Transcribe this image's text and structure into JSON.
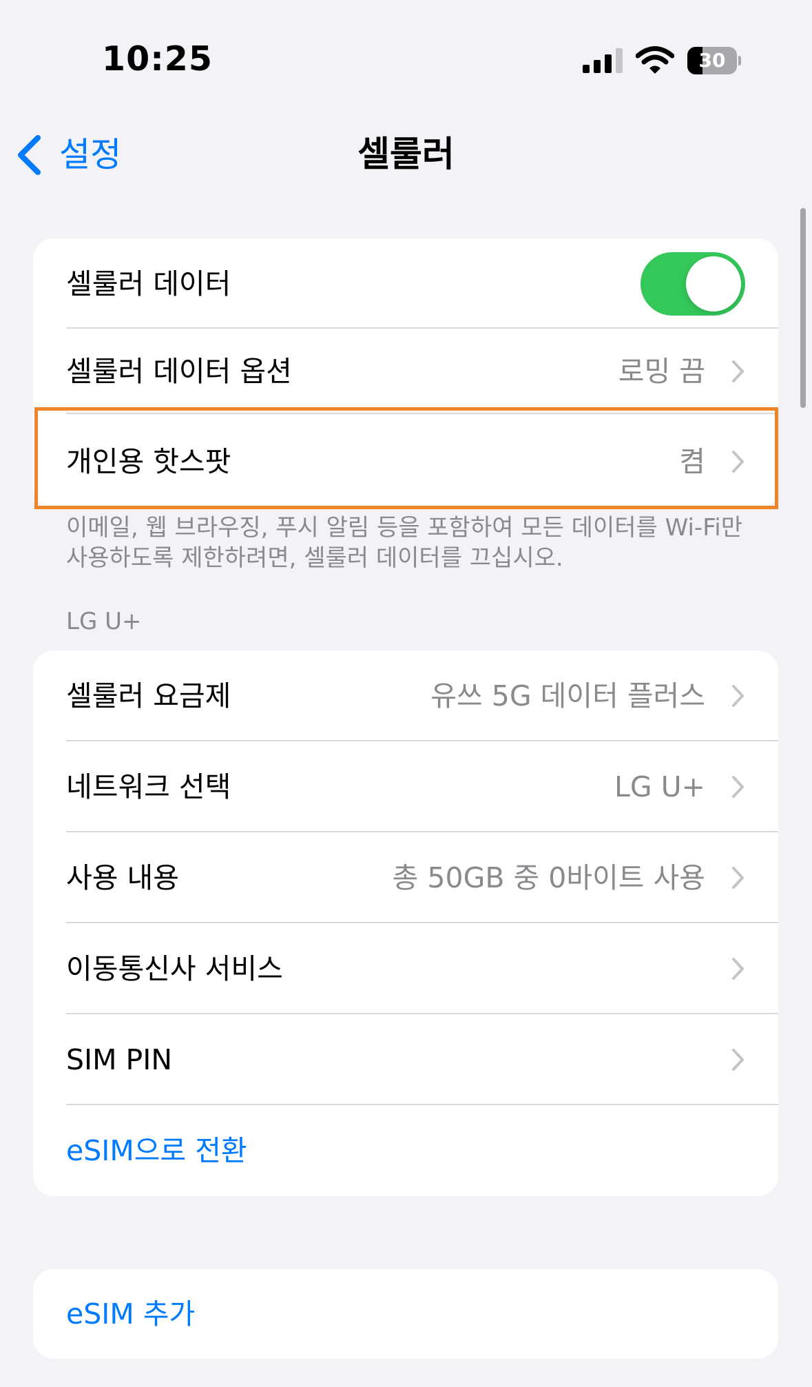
{
  "status_bar": {
    "time": "10:25",
    "battery_level": "30",
    "battery_fraction": 0.3,
    "icons": [
      "cellular-signal-icon",
      "wifi-icon",
      "battery-icon"
    ]
  },
  "nav": {
    "back_label": "설정",
    "title": "셀룰러"
  },
  "colors": {
    "accent": "#007aff",
    "toggle_on": "#34c759",
    "highlight": "#f08428",
    "background": "#f2f2f7"
  },
  "group1": {
    "cellular_data": {
      "label": "셀룰러 데이터",
      "toggle_on": true
    },
    "cellular_data_options": {
      "label": "셀룰러 데이터 옵션",
      "value": "로밍 끔"
    },
    "personal_hotspot": {
      "label": "개인용 핫스팟",
      "value": "켬"
    },
    "footer": "이메일, 웹 브라우징, 푸시 알림 등을 포함하여 모든 데이터를 Wi-Fi만 사용하도록 제한하려면, 셀룰러 데이터를 끄십시오."
  },
  "carrier_section": {
    "header": "LG U+",
    "rows": [
      {
        "label": "셀룰러 요금제",
        "value": "유쓰 5G 데이터 플러스"
      },
      {
        "label": "네트워크 선택",
        "value": "LG U+"
      },
      {
        "label": "사용 내용",
        "value": "총 50GB 중 0바이트 사용"
      },
      {
        "label": "이동통신사 서비스",
        "value": ""
      },
      {
        "label": "SIM PIN",
        "value": ""
      }
    ],
    "switch_to_esim": "eSIM으로 전환"
  },
  "add_esim": {
    "label": "eSIM 추가"
  }
}
